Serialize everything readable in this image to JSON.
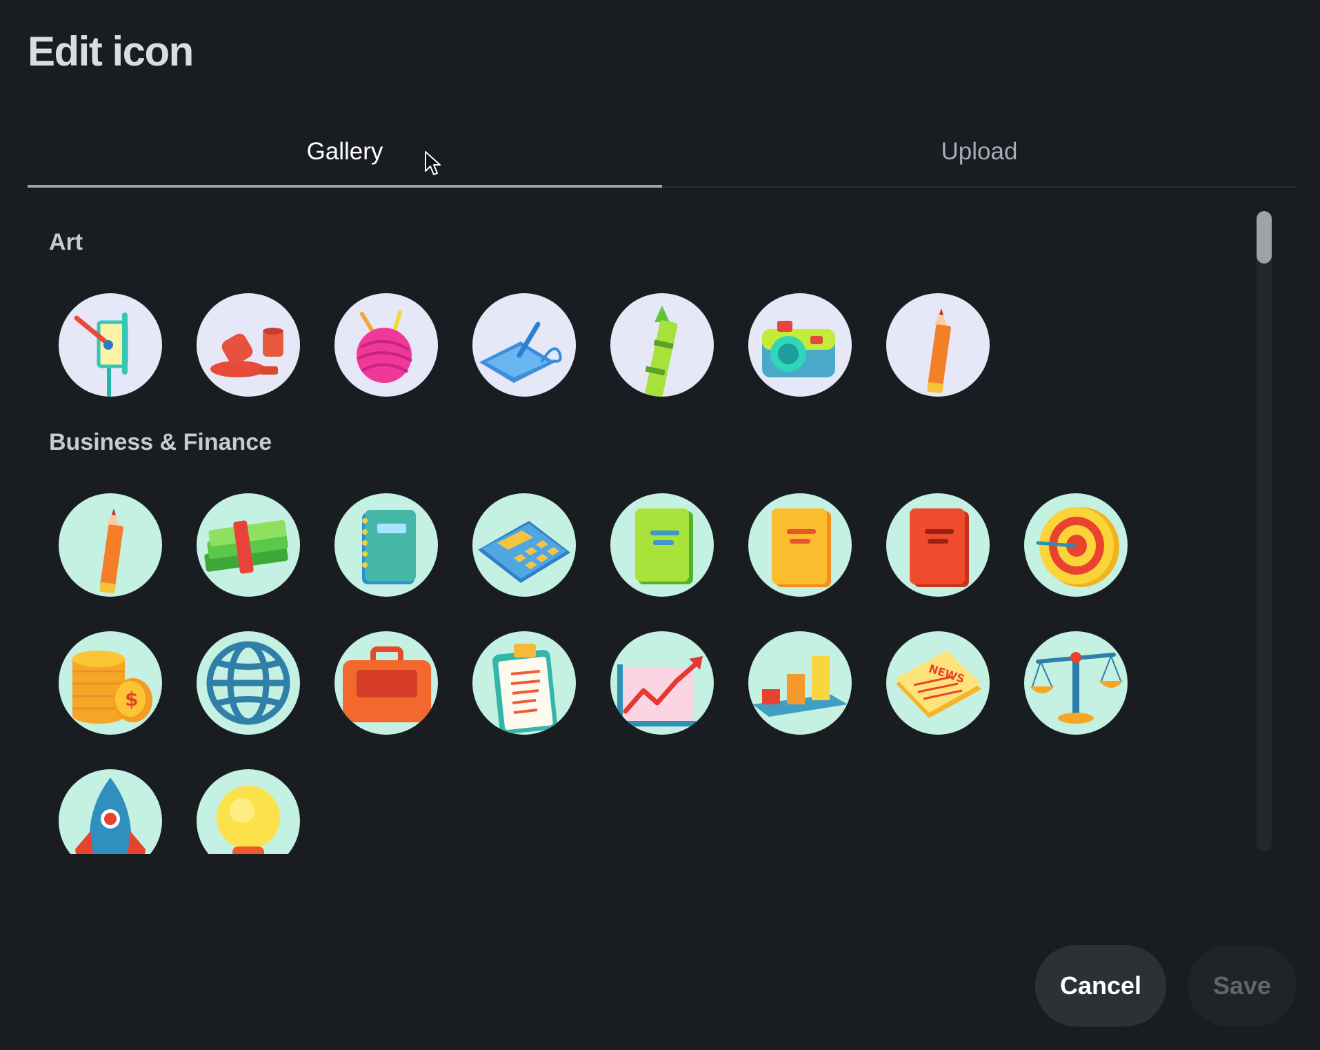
{
  "dialog": {
    "title": "Edit icon"
  },
  "tabs": [
    {
      "label": "Gallery",
      "active": true
    },
    {
      "label": "Upload",
      "active": false
    }
  ],
  "sections": [
    {
      "title": "Art",
      "icons": [
        "easel-icon",
        "spilled-paint-icon",
        "yarn-ball-icon",
        "drawing-tablet-icon",
        "crayon-icon",
        "camera-icon",
        "pencil-icon"
      ]
    },
    {
      "title": "Business & Finance",
      "icons": [
        "pencil-icon",
        "money-stack-icon",
        "notebook-icon",
        "calculator-icon",
        "green-book-icon",
        "yellow-book-icon",
        "red-book-icon",
        "target-icon",
        "coins-icon",
        "globe-icon",
        "briefcase-icon",
        "clipboard-icon",
        "trend-chart-icon",
        "bar-chart-icon",
        "newspaper-icon",
        "scales-icon",
        "rocket-icon",
        "lightbulb-icon"
      ]
    }
  ],
  "footer": {
    "cancel_label": "Cancel",
    "save_label": "Save"
  },
  "colors": {
    "background": "#191c20",
    "art_circle": "#e6e7f7",
    "business_circle": "#c4f1e2",
    "tab_indicator": "#9aa6ae"
  }
}
